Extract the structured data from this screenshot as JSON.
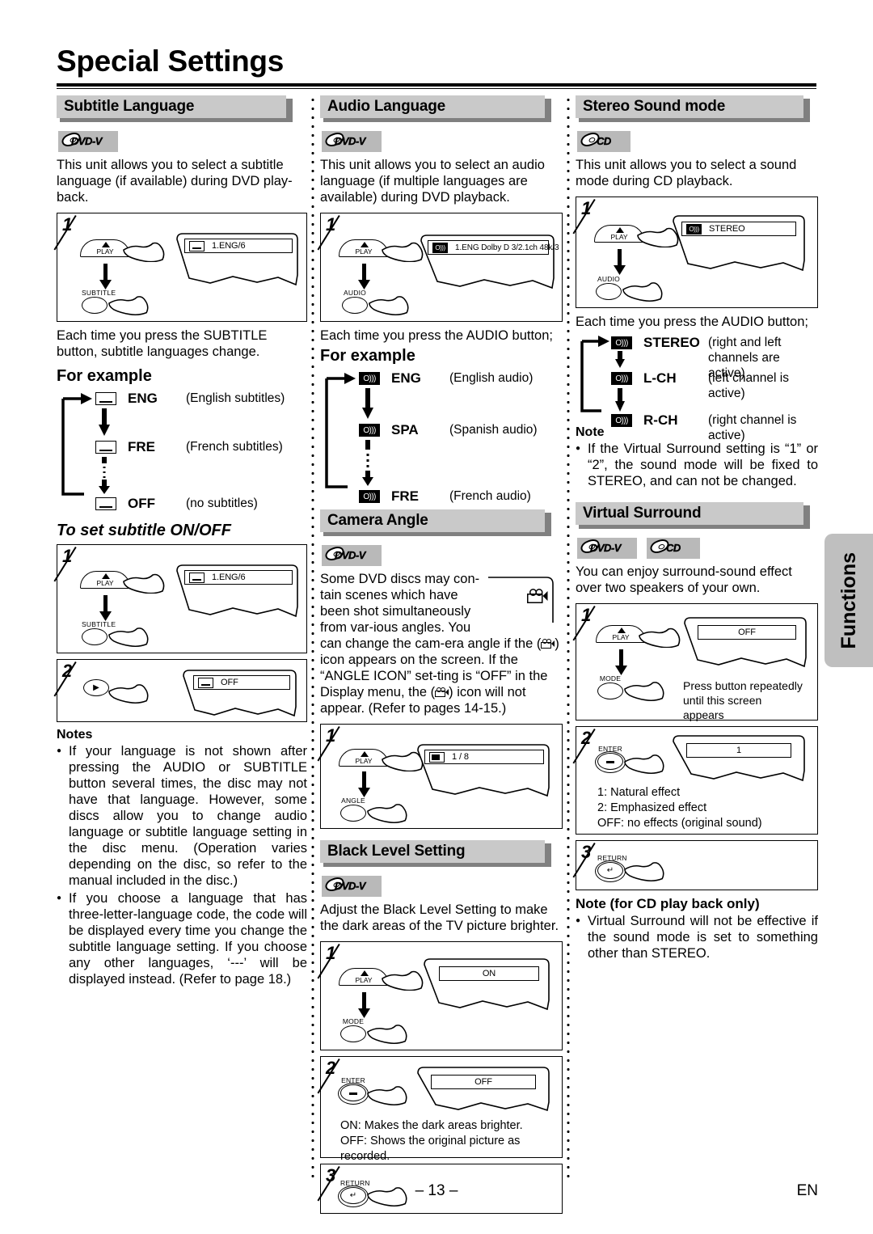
{
  "page": {
    "title": "Special Settings",
    "page_number": "– 13 –",
    "language_mark": "EN",
    "side_tab": "Functions"
  },
  "badges": {
    "dvd": "DVD-V",
    "cd": "CD"
  },
  "column1": {
    "section1": {
      "header": "Subtitle Language",
      "discs": [
        "DVD-V"
      ],
      "intro": "This unit allows you to select a subtitle language (if available) during DVD play-back.",
      "step1": {
        "num": "1",
        "button_play": "PLAY",
        "button_action": "SUBTITLE",
        "osd_text": "1.ENG/6"
      },
      "after_text": "Each time you press the SUBTITLE button, subtitle languages change.",
      "for_example_label": "For example",
      "cycle": [
        {
          "icon": "subtitle-icon",
          "code": "ENG",
          "desc": "(English subtitles)"
        },
        {
          "icon": "subtitle-icon",
          "code": "FRE",
          "desc": "(French subtitles)"
        },
        {
          "icon": "subtitle-icon",
          "code": "OFF",
          "desc": "(no subtitles)"
        }
      ],
      "onoff_label": "To set subtitle ON/OFF",
      "onoff_step1": {
        "num": "1",
        "button_play": "PLAY",
        "button_action": "SUBTITLE",
        "osd_text": "1.ENG/6"
      },
      "onoff_step2": {
        "num": "2",
        "osd_text": "OFF"
      },
      "notes_title": "Notes",
      "notes": [
        "If your language is not shown after pressing the AUDIO or SUBTITLE button several times, the disc may not have that language. However, some discs allow you to change audio language or subtitle language setting in the disc menu. (Operation varies depending on the disc, so refer to the manual included in the disc.)",
        "If you choose a language that has three-letter-language code, the code will be displayed every time you change the subtitle language setting. If you choose any other languages, ‘---’ will be displayed instead. (Refer to page 18.)"
      ]
    }
  },
  "column2": {
    "section_audio": {
      "header": "Audio Language",
      "discs": [
        "DVD-V"
      ],
      "intro": "This unit allows you to select an audio language (if multiple languages are available) during DVD playback.",
      "step1": {
        "num": "1",
        "button_play": "PLAY",
        "button_action": "AUDIO",
        "osd_text": "1.ENG  Dolby D  3/2.1ch  48k/3"
      },
      "after_text": "Each time you press the AUDIO button;",
      "for_example_label": "For example",
      "cycle": [
        {
          "icon": "audio-icon",
          "code": "ENG",
          "desc": "(English audio)"
        },
        {
          "icon": "audio-icon",
          "code": "SPA",
          "desc": "(Spanish audio)"
        },
        {
          "icon": "audio-icon",
          "code": "FRE",
          "desc": "(French audio)"
        }
      ]
    },
    "section_angle": {
      "header": "Camera Angle",
      "discs": [
        "DVD-V"
      ],
      "intro_a": "Some DVD discs may con-tain scenes which have been shot simultaneously from var-ious angles. You can change the cam-era angle if the (",
      "intro_b": ") icon appears on the screen. If the “ANGLE ICON” set-ting is “OFF” in the Display menu, the (",
      "intro_c": ") icon will not appear. (Refer to pages 14-15.)",
      "step1": {
        "num": "1",
        "button_play": "PLAY",
        "button_action": "ANGLE",
        "osd_text": "1 / 8"
      }
    },
    "section_black": {
      "header": "Black Level Setting",
      "discs": [
        "DVD-V"
      ],
      "intro": "Adjust the Black Level Setting to make the dark areas of the TV picture brighter.",
      "step1": {
        "num": "1",
        "button_play": "PLAY",
        "button_action": "MODE",
        "osd_text": "ON"
      },
      "step2": {
        "num": "2",
        "button_action": "ENTER",
        "osd_text": "OFF",
        "note_line1": "ON: Makes the dark areas brighter.",
        "note_line2": "OFF: Shows the original picture as recorded."
      },
      "step3": {
        "num": "3",
        "button_action": "RETURN"
      }
    }
  },
  "column3": {
    "section_stereo": {
      "header": "Stereo Sound mode",
      "discs": [
        "CD"
      ],
      "intro": "This unit allows you to select a sound mode during CD playback.",
      "step1": {
        "num": "1",
        "button_play": "PLAY",
        "button_action": "AUDIO",
        "osd_text": "STEREO"
      },
      "after_text": "Each time you press the AUDIO button;",
      "cycle": [
        {
          "icon": "audio-icon",
          "code": "STEREO",
          "desc": "(right and left channels are active)"
        },
        {
          "icon": "audio-icon",
          "code": "L-CH",
          "desc": "(left channel is active)"
        },
        {
          "icon": "audio-icon",
          "code": "R-CH",
          "desc": "(right channel is active)"
        }
      ],
      "note_title": "Note",
      "note": "If the Virtual Surround setting is “1” or “2”, the sound mode will be fixed to STEREO, and can not be changed."
    },
    "section_virtual": {
      "header": "Virtual Surround",
      "discs": [
        "DVD-V",
        "CD"
      ],
      "intro": "You can enjoy surround-sound effect over two speakers of your own.",
      "step1": {
        "num": "1",
        "button_play": "PLAY",
        "button_action": "MODE",
        "osd_text": "OFF",
        "inline_note": "Press button repeatedly until this screen appears"
      },
      "step2": {
        "num": "2",
        "button_action": "ENTER",
        "osd_text": "1",
        "note_line1": "1: Natural effect",
        "note_line2": "2: Emphasized effect",
        "note_line3": "OFF: no effects (original sound)"
      },
      "step3": {
        "num": "3",
        "button_action": "RETURN"
      },
      "note_title": "Note (for CD play back only)",
      "note": "Virtual Surround will not be effective if the sound mode is set to something other than STEREO."
    }
  },
  "colors": {
    "header_fill": "#c9c9c9",
    "header_shadow": "#808080",
    "badge_fill": "#b9b9b9",
    "side_tab": "#bfbfbf"
  }
}
